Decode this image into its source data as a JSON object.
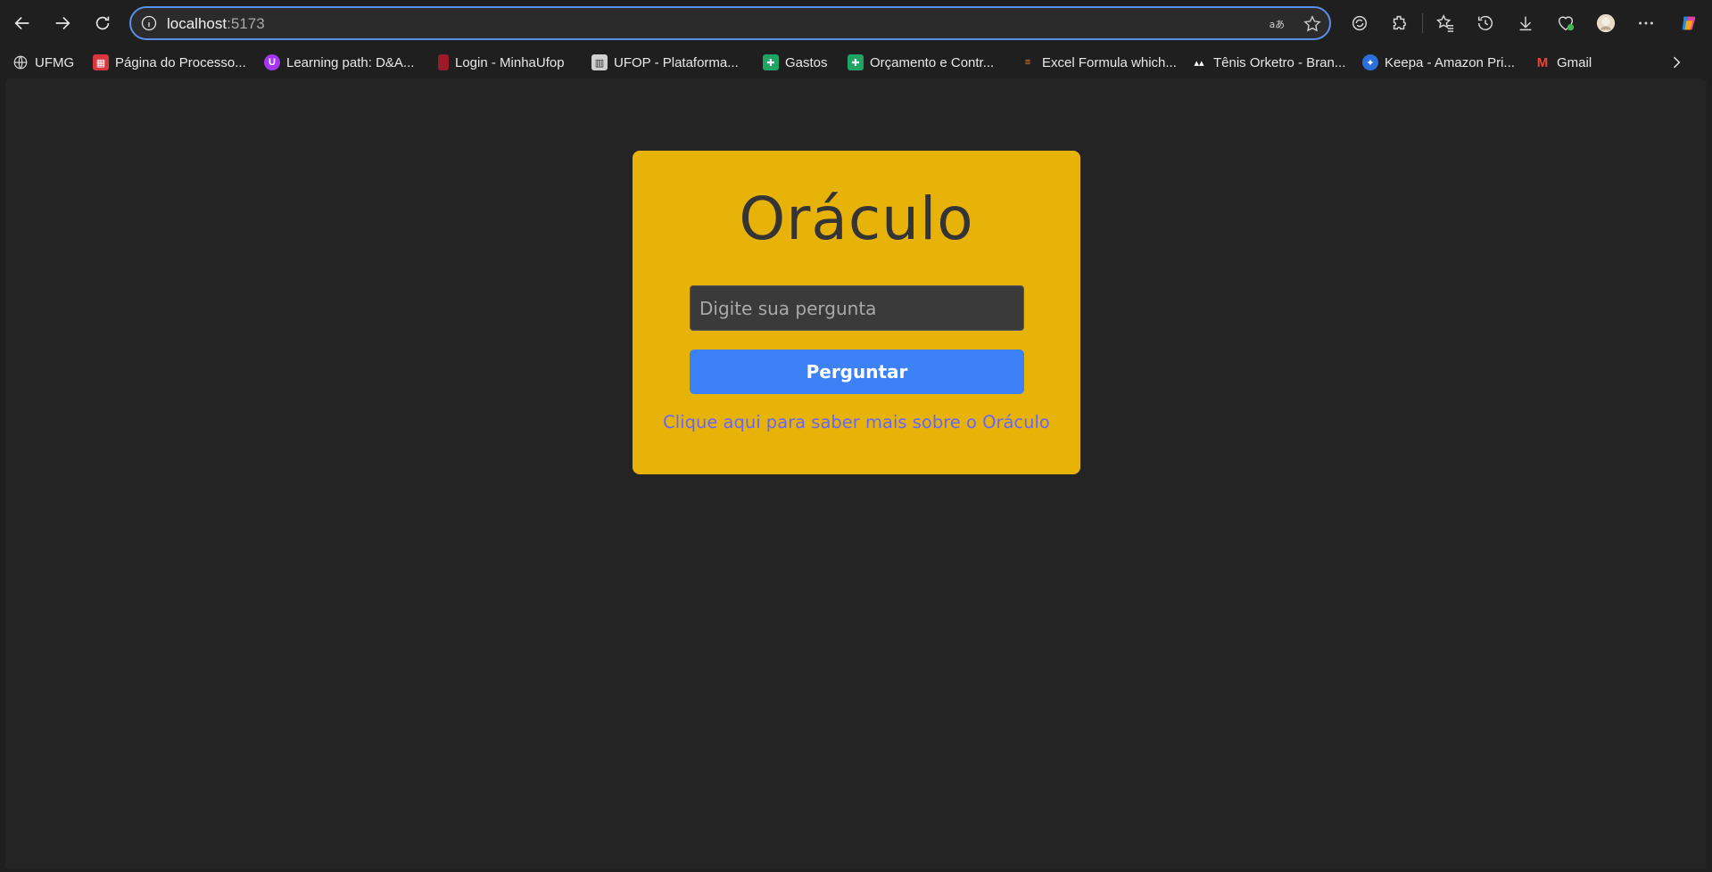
{
  "browser": {
    "address": {
      "host": "localhost",
      "port": ":5173"
    },
    "bookmarks": [
      {
        "label": "UFMG",
        "icon": "globe-icon",
        "color": "#cfcfcf"
      },
      {
        "label": "Página do Processo...",
        "icon": "processo-icon",
        "color": "#d9363e"
      },
      {
        "label": "Learning path: D&A...",
        "icon": "udemy-icon",
        "color": "#a435f0"
      },
      {
        "label": "Login - MinhaUfop",
        "icon": "ufop-icon",
        "color": "#9b1b2b"
      },
      {
        "label": "UFOP - Plataforma...",
        "icon": "chart-icon",
        "color": "#d0d0d0"
      },
      {
        "label": "Gastos",
        "icon": "sheets-icon",
        "color": "#1fa463"
      },
      {
        "label": "Orçamento e Contr...",
        "icon": "sheets-icon",
        "color": "#1fa463"
      },
      {
        "label": "Excel Formula which...",
        "icon": "stackoverflow-icon",
        "color": "#f48024"
      },
      {
        "label": "Tênis Orketro - Bran...",
        "icon": "adidas-icon",
        "color": "#ffffff"
      },
      {
        "label": "Keepa - Amazon Pri...",
        "icon": "keepa-icon",
        "color": "#2a6fdb"
      },
      {
        "label": "Gmail",
        "icon": "gmail-icon",
        "color": "#ea4335"
      }
    ]
  },
  "page": {
    "title": "Oráculo",
    "input_placeholder": "Digite sua pergunta",
    "button_label": "Perguntar",
    "link_text": "Clique aqui para saber mais sobre o Oráculo",
    "colors": {
      "card": "#e8b308",
      "button": "#3c82f6",
      "link": "#6666ff",
      "background": "#242424"
    }
  }
}
